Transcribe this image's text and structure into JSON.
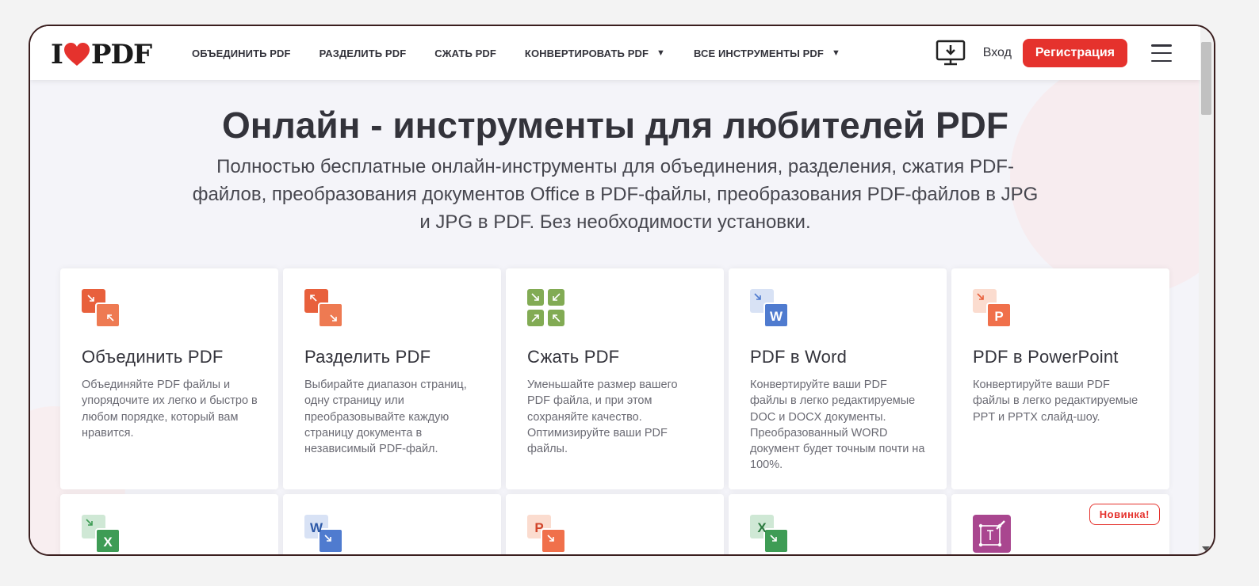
{
  "header": {
    "logo": {
      "left": "I",
      "right": "PDF"
    },
    "nav": [
      {
        "label": "ОБЪЕДИНИТЬ PDF"
      },
      {
        "label": "РАЗДЕЛИТЬ PDF"
      },
      {
        "label": "СЖАТЬ PDF"
      },
      {
        "label": "КОНВЕРТИРОВАТЬ PDF",
        "caret": "▼"
      },
      {
        "label": "ВСЕ ИНСТРУМЕНТЫ PDF",
        "caret": "▼"
      }
    ],
    "login": "Вход",
    "signup": "Регистрация"
  },
  "hero": {
    "title": "Онлайн - инструменты для любителей PDF",
    "subtitle": "Полностью бесплатные онлайн-инструменты для объединения, разделения, сжатия PDF-файлов, преобразования документов Office в PDF-файлы, преобразования PDF-файлов в JPG и JPG в PDF. Без необходимости установки."
  },
  "tools": [
    {
      "title": "Объединить PDF",
      "desc": "Объединяйте PDF файлы и упорядочите их легко и быстро в любом порядке, который вам нравится.",
      "icon": "merge-icon"
    },
    {
      "title": "Разделить PDF",
      "desc": "Выбирайте диапазон страниц, одну страницу или преобразовывайте каждую страницу документа в независимый PDF-файл.",
      "icon": "split-icon"
    },
    {
      "title": "Сжать PDF",
      "desc": "Уменьшайте размер вашего PDF файла, и при этом сохраняйте качество. Оптимизируйте ваши PDF файлы.",
      "icon": "compress-icon"
    },
    {
      "title": "PDF в Word",
      "desc": "Конвертируйте ваши PDF файлы в легко редактируемые DOC и DOCX документы. Преобразованный WORD документ будет точным почти на 100%.",
      "icon": "pdf-to-word-icon"
    },
    {
      "title": "PDF в PowerPoint",
      "desc": "Конвертируйте ваши PDF файлы в легко редактируемые PPT и PPTX слайд-шоу.",
      "icon": "pdf-to-powerpoint-icon"
    }
  ],
  "tools_row2": [
    {
      "icon": "pdf-to-excel-icon",
      "letter": "X"
    },
    {
      "icon": "word-to-pdf-icon",
      "letter": "W"
    },
    {
      "icon": "powerpoint-to-pdf-icon",
      "letter": "P"
    },
    {
      "icon": "excel-to-pdf-icon",
      "letter": "X"
    },
    {
      "icon": "edit-pdf-icon",
      "letter": "",
      "badge": "Новинка!"
    }
  ],
  "colors": {
    "brand_red": "#e5322d",
    "merge_orange": "#e8603c",
    "compress_green": "#82ab54",
    "word_blue": "#4f7bcf",
    "powerpoint_orange": "#f0704b",
    "excel_green": "#3e9c55",
    "edit_purple": "#a9468f"
  }
}
